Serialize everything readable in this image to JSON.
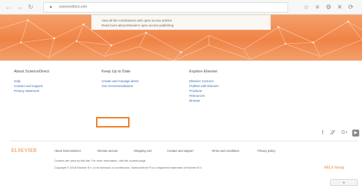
{
  "browser": {
    "url": "sciencedirect.com",
    "nav_icons": [
      "back-icon",
      "forward-icon",
      "reload-icon"
    ],
    "toolbar_icons": [
      "star-icon",
      "reading-list-icon",
      "settings-icon",
      "close-icon",
      "sync-icon"
    ]
  },
  "banner": {
    "line1": "View all the contributions with open access articles",
    "line2": "Read more about Elsevier's open access publishing"
  },
  "footer": {
    "columns": [
      {
        "heading": "About ScienceDirect",
        "links": [
          "Help",
          "Contact and support",
          "Privacy statement"
        ]
      },
      {
        "heading": "Keep Up to Date",
        "links": [
          "Create and manage alerts",
          "Get recommendations"
        ]
      },
      {
        "heading": "Explore Elsevier",
        "links": [
          "Elsevier Connect",
          "Publish with Elsevier",
          "Products",
          "Resources",
          "Browse"
        ]
      }
    ],
    "social_icons": [
      "facebook-icon",
      "twitter-icon",
      "google-plus-icon",
      "youtube-icon"
    ],
    "logo": "ELSEVIER",
    "bottom_links": [
      "About ScienceDirect",
      "Remote access",
      "Shopping cart",
      "Contact and support",
      "Terms and conditions",
      "Privacy policy"
    ],
    "legal_line1": "Cookies are used by this site. For more information, visit the cookies page.",
    "legal_line2": "Copyright © 2018 Elsevier B.V. or its licensors or contributors. ScienceDirect ® is a registered trademark of Elsevier B.V.",
    "relx_logo": "RELX Group"
  },
  "colors": {
    "accent": "#f07a1e",
    "banner": "#ef8346",
    "link": "#3a6bb0"
  }
}
